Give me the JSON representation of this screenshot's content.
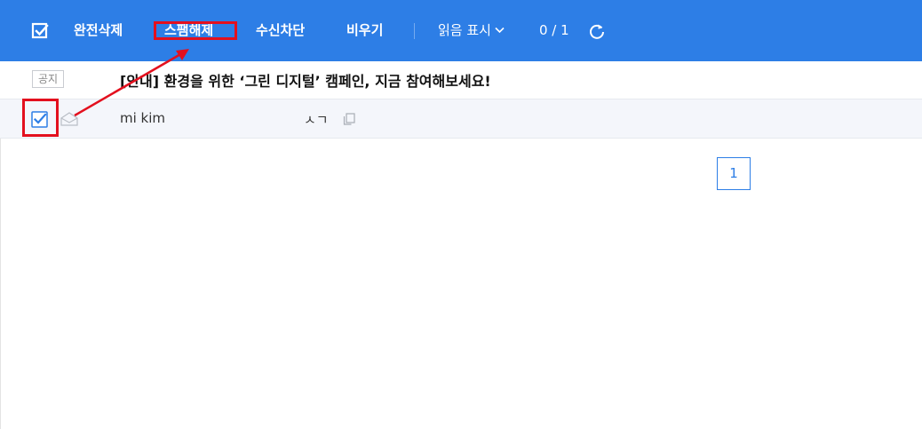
{
  "toolbar": {
    "buttons": [
      {
        "label": "완전삭제"
      },
      {
        "label": "스팸해제"
      },
      {
        "label": "수신차단"
      },
      {
        "label": "비우기"
      }
    ],
    "read_label": "읽음 표시",
    "count": "0 / 1",
    "background": "#2d7ee6"
  },
  "notice": {
    "badge": "공지",
    "title": "[안내] 환경을 위한 ‘그린 디지털’ 캠페인, 지금 참여해보세요!"
  },
  "mail": {
    "sender": "mi kim",
    "subject": "ㅅㄱ"
  },
  "pagination": {
    "current": "1"
  },
  "annotation": {
    "color": "#e3101e"
  }
}
